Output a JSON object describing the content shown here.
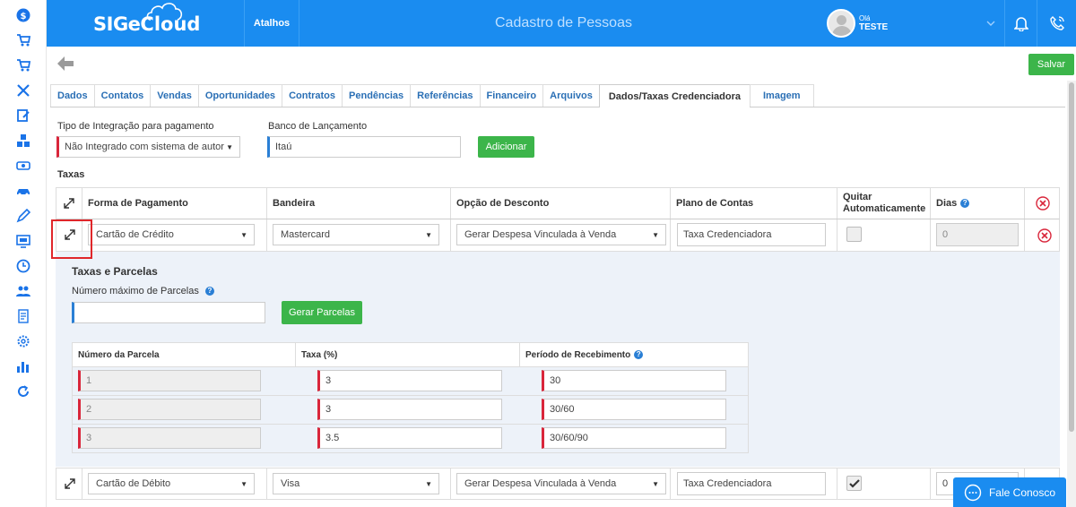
{
  "header": {
    "logo_sige": "SIGe",
    "logo_cloud": "Cloud",
    "atalhos": "Atalhos",
    "page_title": "Cadastro de Pessoas",
    "user_hello": "Olá",
    "user_name": "TESTE"
  },
  "toolbar": {
    "save_label": "Salvar"
  },
  "tabs": [
    {
      "label": "Dados"
    },
    {
      "label": "Contatos"
    },
    {
      "label": "Vendas"
    },
    {
      "label": "Oportunidades"
    },
    {
      "label": "Contratos"
    },
    {
      "label": "Pendências"
    },
    {
      "label": "Referências"
    },
    {
      "label": "Financeiro"
    },
    {
      "label": "Arquivos"
    },
    {
      "label": "Dados/Taxas Credenciadora"
    },
    {
      "label": "Imagem"
    }
  ],
  "form": {
    "tipo_label": "Tipo de Integração para pagamento",
    "tipo_value": "Não Integrado com sistema de autor",
    "banco_label": "Banco de Lançamento",
    "banco_value": "Itaú",
    "adicionar_label": "Adicionar",
    "taxas_title": "Taxas"
  },
  "table": {
    "headers": {
      "forma": "Forma de Pagamento",
      "bandeira": "Bandeira",
      "opcao": "Opção de Desconto",
      "plano": "Plano de Contas",
      "quitar": "Quitar Automaticamente",
      "dias": "Dias"
    },
    "rows": [
      {
        "forma": "Cartão de Crédito",
        "bandeira": "Mastercard",
        "opcao": "Gerar Despesa Vinculada à Venda",
        "plano": "Taxa Credenciadora",
        "quitar": false,
        "dias": "0"
      },
      {
        "forma": "Cartão de Débito",
        "bandeira": "Visa",
        "opcao": "Gerar Despesa Vinculada à Venda",
        "plano": "Taxa Credenciadora",
        "quitar": true,
        "dias": "0"
      }
    ]
  },
  "panel": {
    "title": "Taxas e Parcelas",
    "max_label": "Número máximo de Parcelas",
    "max_value": "",
    "gerar_label": "Gerar Parcelas",
    "headers": {
      "numero": "Número da Parcela",
      "taxa": "Taxa (%)",
      "periodo": "Período de Recebimento"
    },
    "rows": [
      {
        "numero": "1",
        "taxa": "3",
        "periodo": "30"
      },
      {
        "numero": "2",
        "taxa": "3",
        "periodo": "30/60"
      },
      {
        "numero": "3",
        "taxa": "3.5",
        "periodo": "30/60/90"
      }
    ]
  },
  "fale_conosco": "Fale Conosco",
  "colors": {
    "primary": "#1a8cf0",
    "success": "#3cb54a",
    "danger": "#d9263b"
  },
  "sidebar_icons": [
    "dollar-icon",
    "cart-icon",
    "cart-icon",
    "tools-icon",
    "edit-icon",
    "boxes-icon",
    "money-icon",
    "car-icon",
    "pen-icon",
    "monitor-icon",
    "clock-icon",
    "users-icon",
    "report-icon",
    "gear-icon",
    "chart-icon",
    "sync-icon"
  ]
}
